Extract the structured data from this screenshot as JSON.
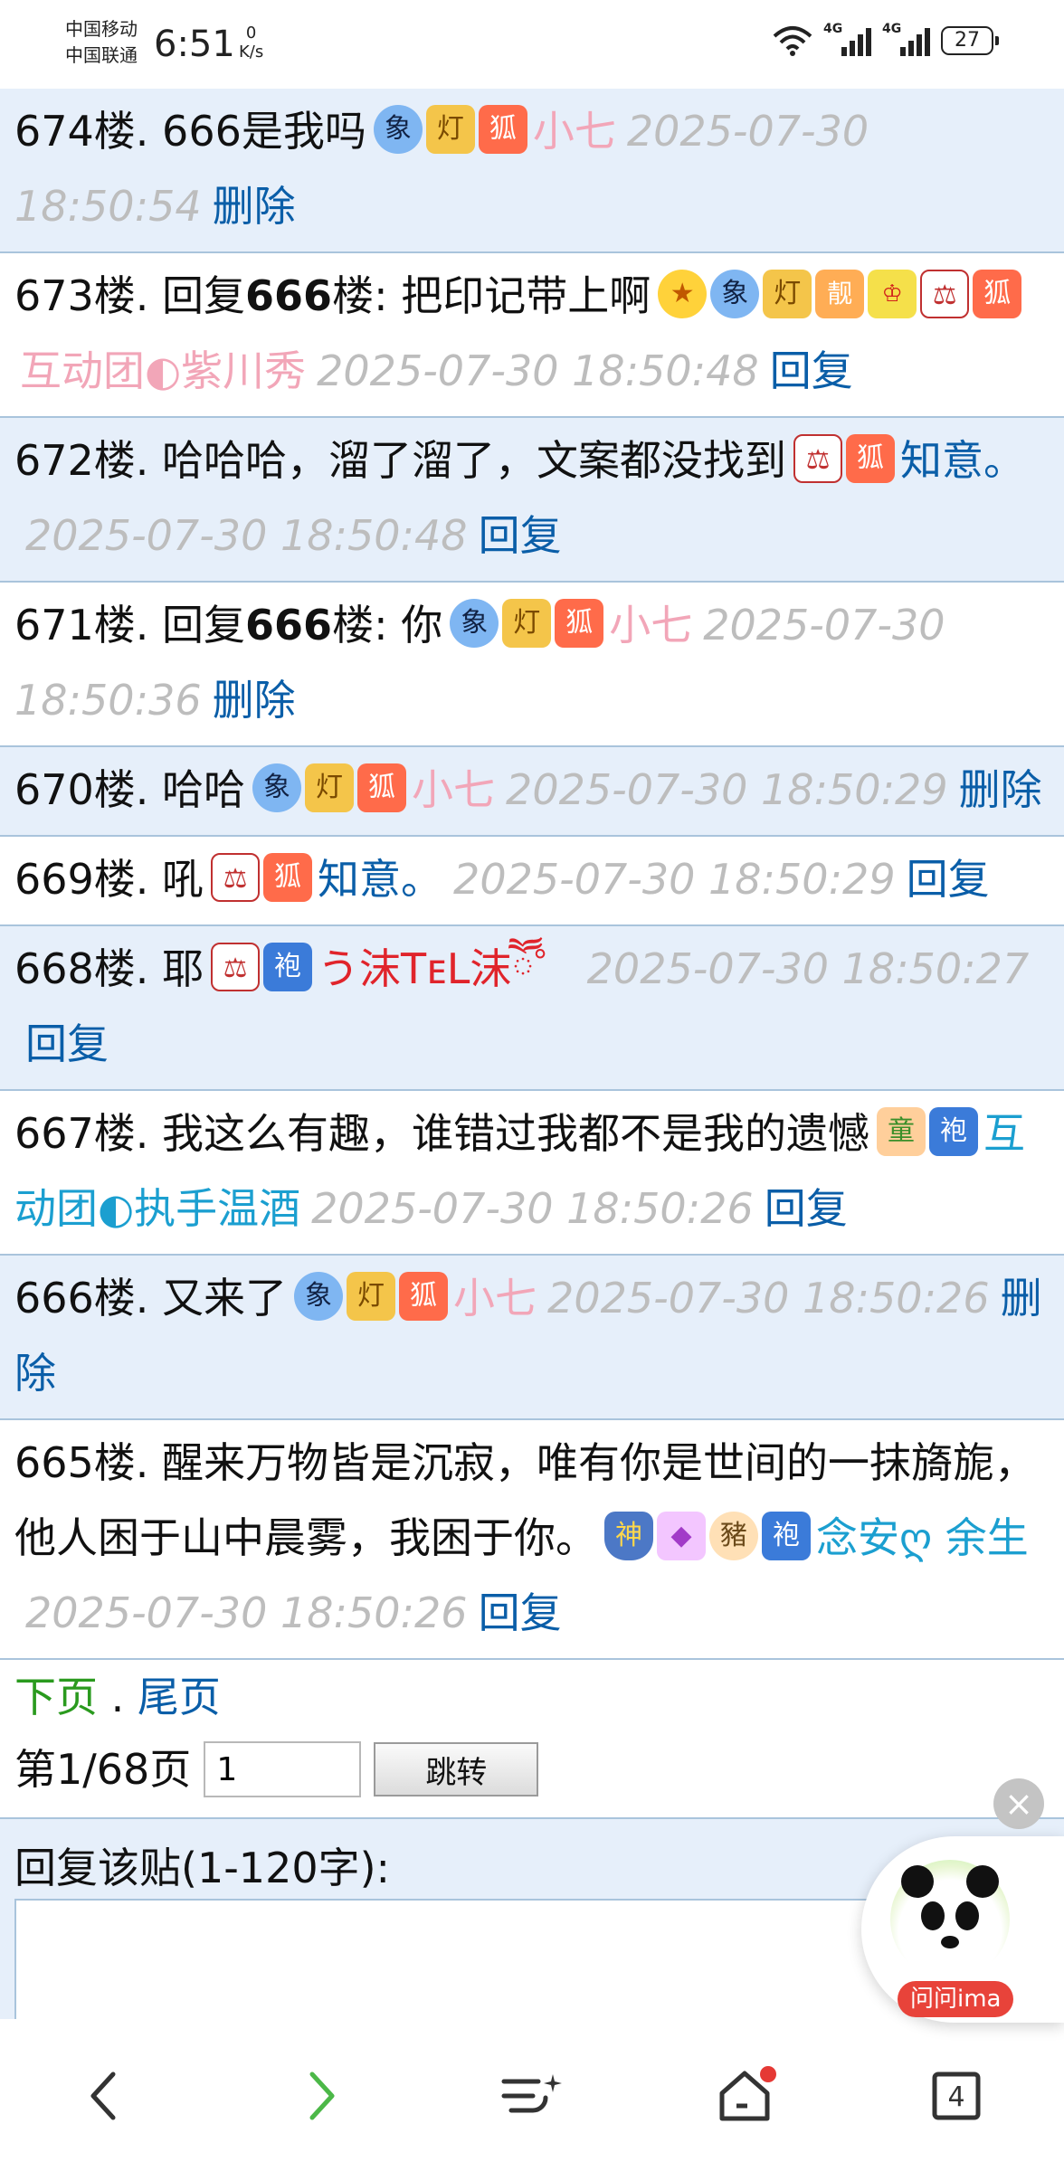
{
  "status_bar": {
    "carrier1": "中国移动",
    "carrier2": "中国联通",
    "time": "6:51",
    "speed_value": "0",
    "speed_unit": "K/s",
    "net1": "4G",
    "net2": "4G",
    "battery": "27"
  },
  "posts": [
    {
      "floor": "674楼.",
      "pre": "",
      "bold": "",
      "post": "666是我吗",
      "icons": [
        "elephant-icon",
        "lamp-icon",
        "fox-icon"
      ],
      "user": "小七",
      "user_color": "#f2a6b8",
      "time": "2025-07-30 18:50:54",
      "action": "删除",
      "bg": "alt"
    },
    {
      "floor": "673楼.",
      "pre": "回复",
      "bold": "666",
      "post": "楼: 把印记带上啊",
      "icons": [
        "star-icon",
        "elephant-icon",
        "lamp-icon",
        "bang-icon",
        "crown-icon",
        "scale-icon",
        "fox-icon"
      ],
      "user": "互动团◐紫川秀",
      "user_color": "#f2a6b8",
      "time": "2025-07-30 18:50:48",
      "action": "回复",
      "bg": "normal"
    },
    {
      "floor": "672楼.",
      "pre": "",
      "bold": "",
      "post": "哈哈哈，溜了溜了，文案都没找到",
      "icons": [
        "scale-icon",
        "fox-icon"
      ],
      "user": "知意。",
      "user_color": "#0a5ea8",
      "time": "2025-07-30 18:50:48",
      "action": "回复",
      "bg": "alt"
    },
    {
      "floor": "671楼.",
      "pre": "回复",
      "bold": "666",
      "post": "楼: 你",
      "icons": [
        "elephant-icon",
        "lamp-icon",
        "fox-icon"
      ],
      "user": "小七",
      "user_color": "#f2a6b8",
      "time": "2025-07-30 18:50:36",
      "action": "删除",
      "bg": "normal"
    },
    {
      "floor": "670楼.",
      "pre": "",
      "bold": "",
      "post": "哈哈",
      "icons": [
        "elephant-icon",
        "lamp-icon",
        "fox-icon"
      ],
      "user": "小七",
      "user_color": "#f2a6b8",
      "time": "2025-07-30 18:50:29",
      "action": "删除",
      "bg": "alt"
    },
    {
      "floor": "669楼.",
      "pre": "",
      "bold": "",
      "post": "吼",
      "icons": [
        "scale-icon",
        "fox-icon"
      ],
      "user": "知意。",
      "user_color": "#0a5ea8",
      "time": "2025-07-30 18:50:29",
      "action": "回复",
      "bg": "normal"
    },
    {
      "floor": "668楼.",
      "pre": "",
      "bold": "",
      "post": "耶",
      "icons": [
        "scale-icon",
        "robe-icon"
      ],
      "user": "う沫TᴇL沫ཽ゜",
      "user_color": "#e0242b",
      "time": "2025-07-30 18:50:27",
      "action": "回复",
      "bg": "alt"
    },
    {
      "floor": "667楼.",
      "pre": "",
      "bold": "",
      "post": "我这么有趣，谁错过我都不是我的遗憾",
      "icons": [
        "kid-icon",
        "robe-icon"
      ],
      "user": "互动团◐执手温酒",
      "user_color": "#1b9fd0",
      "time": "2025-07-30 18:50:26",
      "action": "回复",
      "bg": "normal"
    },
    {
      "floor": "666楼.",
      "pre": "",
      "bold": "",
      "post": "又来了",
      "icons": [
        "elephant-icon",
        "lamp-icon",
        "fox-icon"
      ],
      "user": "小七",
      "user_color": "#f2a6b8",
      "time": "2025-07-30 18:50:26",
      "action": "删除",
      "bg": "alt"
    },
    {
      "floor": "665楼.",
      "pre": "",
      "bold": "",
      "post": "醒来万物皆是沉寂，唯有你是世间的一抹旖旎，他人困于山中晨雾，我困于你。",
      "icons": [
        "shield-icon",
        "gem-icon",
        "pig-icon",
        "robe-icon"
      ],
      "user": "念安ღ 余生",
      "user_color": "#1b9fd0",
      "time": "2025-07-30 18:50:26",
      "action": "回复",
      "bg": "normal"
    }
  ],
  "pager": {
    "next": "下页",
    "sep": " . ",
    "last": "尾页",
    "page_info": "第1/68页",
    "page_input": "1",
    "jump": "跳转"
  },
  "reply": {
    "label": "回复该贴(1-120字):"
  },
  "assistant": {
    "label": "问问ima",
    "close": "×"
  },
  "bottom_nav": {
    "tab_count": "4"
  },
  "icon_glyphs": {
    "elephant-icon": "象",
    "lamp-icon": "灯",
    "fox-icon": "狐",
    "scale-icon": "⚖",
    "star-icon": "★",
    "robe-icon": "袍",
    "kid-icon": "童",
    "shield-icon": "神",
    "gem-icon": "◆",
    "pig-icon": "豬",
    "bang-icon": "靓",
    "crown-icon": "♔"
  },
  "icon_classes": {
    "elephant-icon": "i-elephant",
    "lamp-icon": "i-lamp",
    "fox-icon": "i-fox",
    "scale-icon": "i-scale",
    "star-icon": "i-star",
    "robe-icon": "i-robe",
    "kid-icon": "i-kid",
    "shield-icon": "i-shield",
    "gem-icon": "i-gem",
    "pig-icon": "i-pig",
    "bang-icon": "i-bang",
    "crown-icon": "i-crown"
  }
}
